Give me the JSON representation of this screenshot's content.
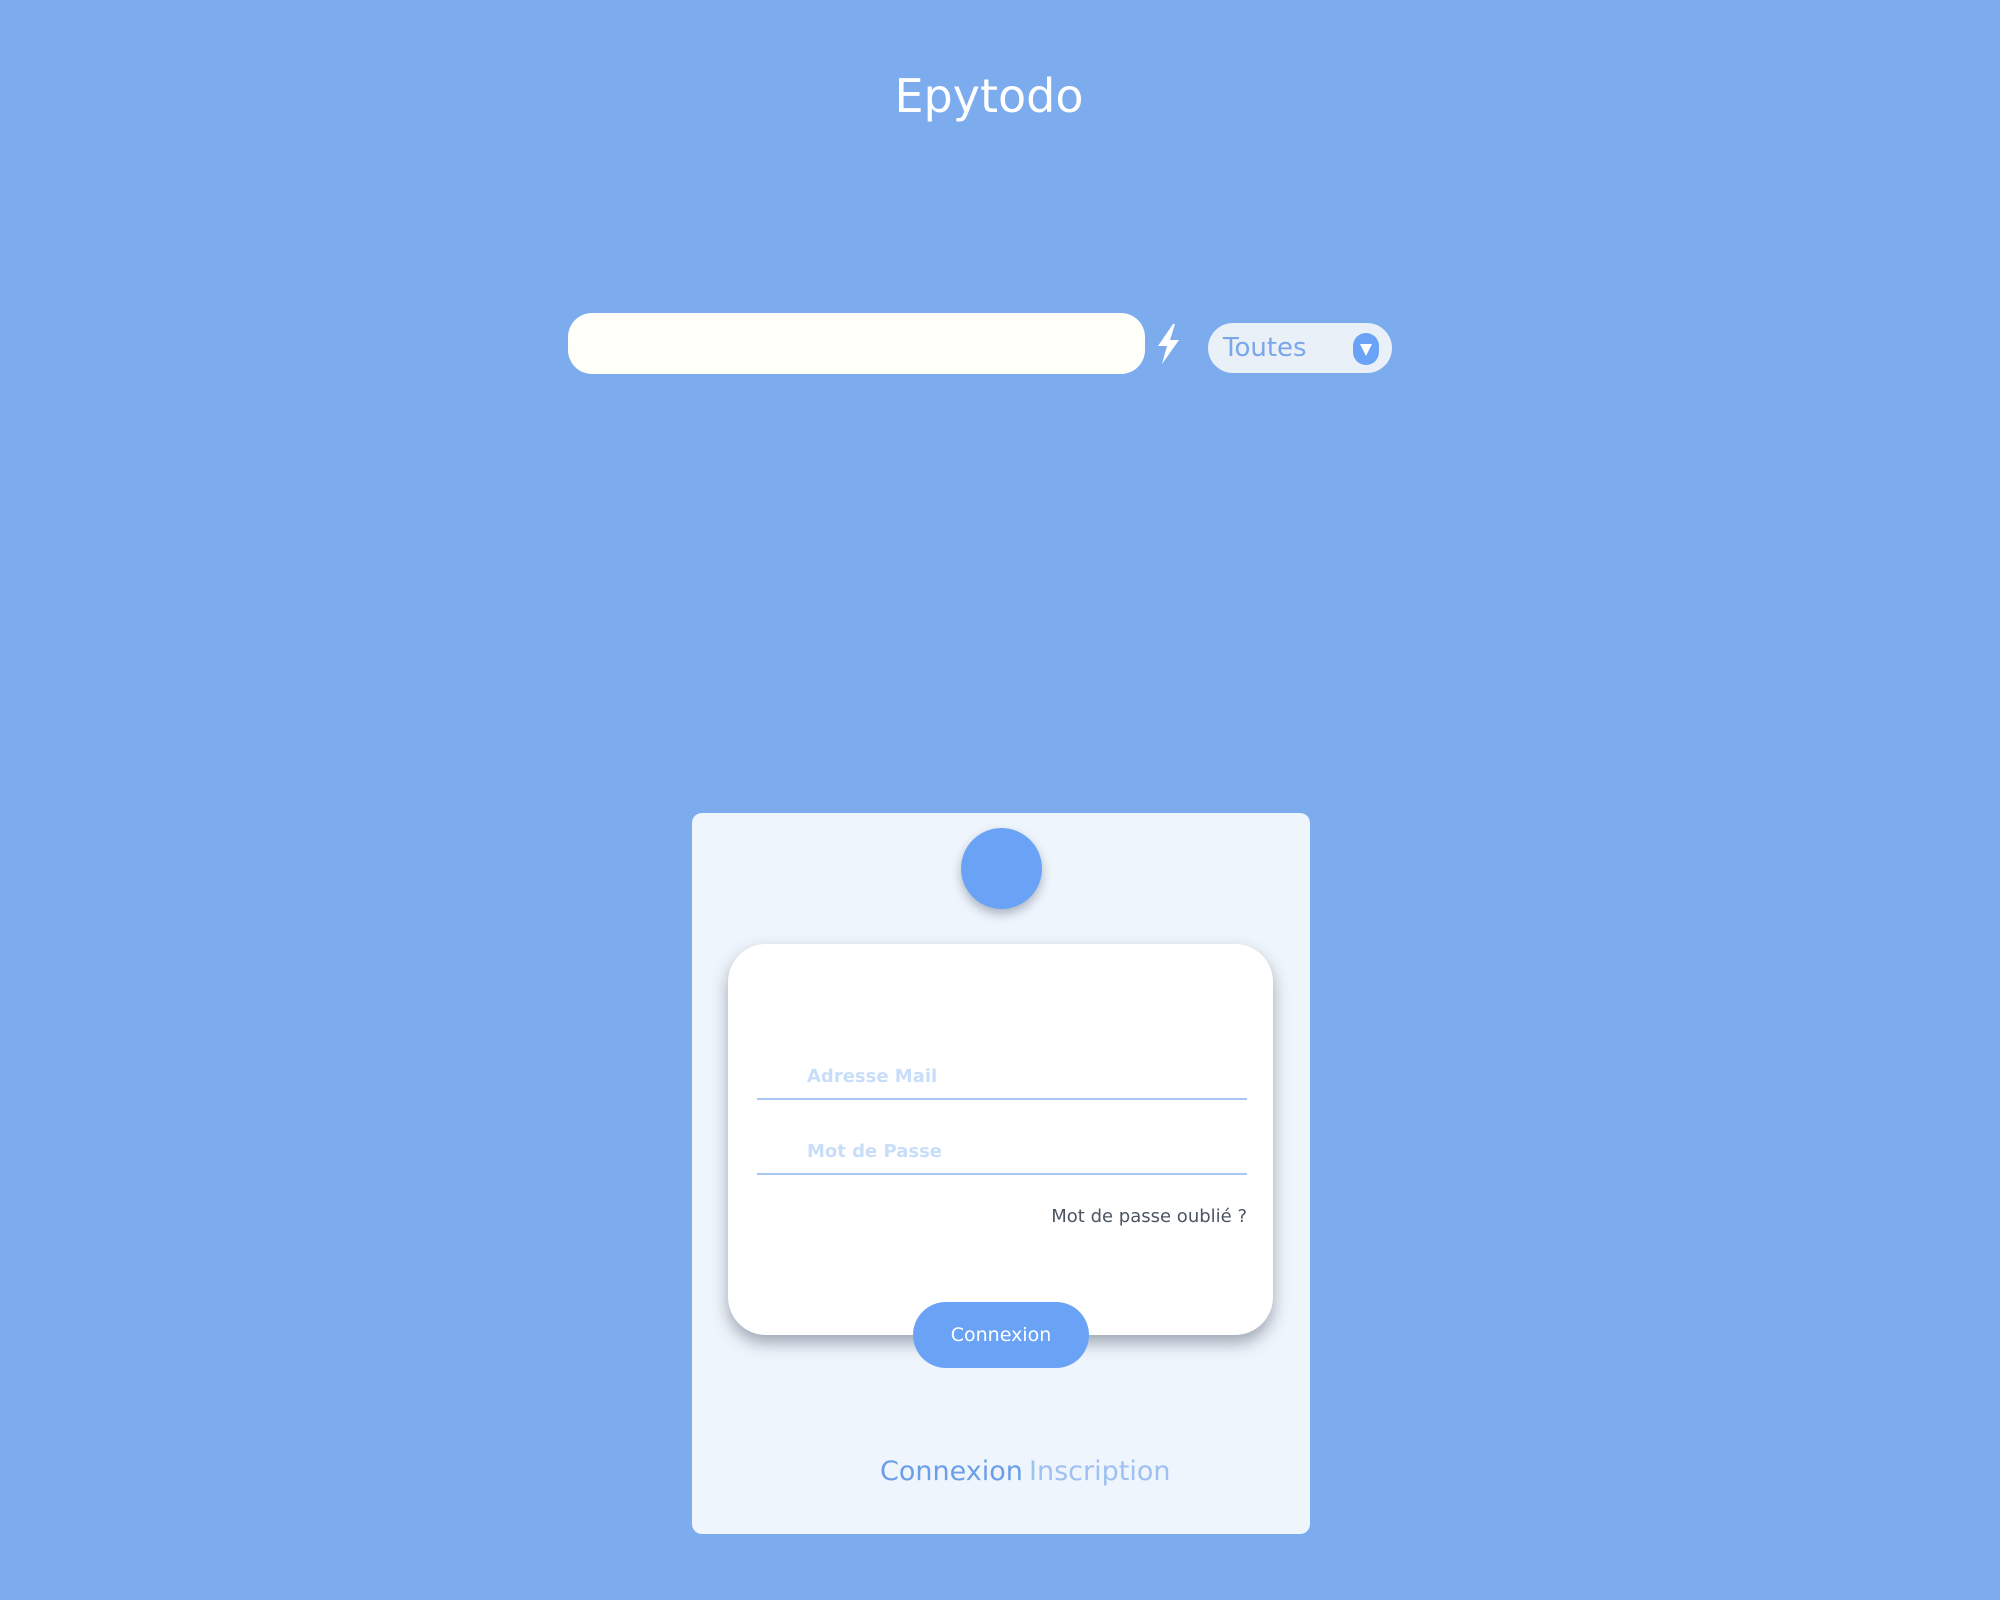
{
  "header": {
    "title": "Epytodo"
  },
  "search": {
    "value": "",
    "placeholder": ""
  },
  "filter": {
    "selected": "Toutes"
  },
  "login": {
    "email_placeholder": "Adresse Mail",
    "password_placeholder": "Mot de Passe",
    "forgot_password": "Mot de passe oublié ?",
    "submit_label": "Connexion"
  },
  "tabs": [
    {
      "label": "Connexion",
      "active": true
    },
    {
      "label": "Inscription",
      "active": false
    }
  ],
  "icons": {
    "search_action": "lightning-bolt-icon",
    "filter_toggle": "triangle-down-icon",
    "avatar": "avatar-circle"
  },
  "colors": {
    "background": "#7cacee",
    "accent": "#6aa2f6",
    "panel": "#eff5fc",
    "card": "#ffffff",
    "search_field": "#fffffa",
    "muted_text": "#4b5563"
  }
}
